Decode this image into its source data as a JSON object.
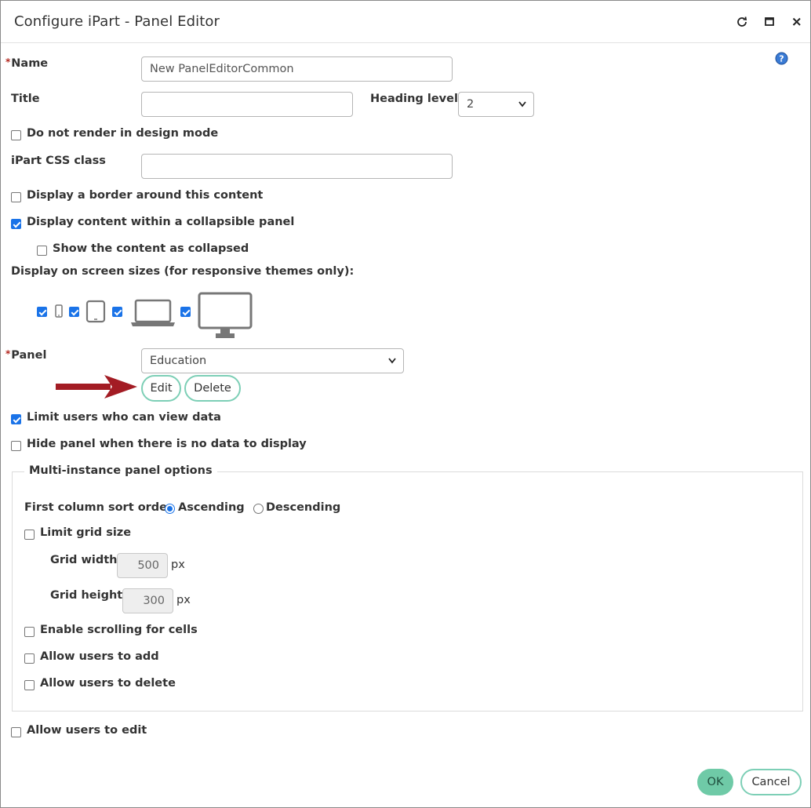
{
  "dialog": {
    "title": "Configure iPart - Panel Editor",
    "controls": [
      "refresh-icon",
      "maximize-icon",
      "close-icon"
    ]
  },
  "form": {
    "required_marker": "*",
    "name_label": "Name",
    "name_value": "New PanelEditorCommon",
    "title_label": "Title",
    "title_value": "",
    "heading_level_label": "Heading level",
    "heading_level_value": "2",
    "no_render_label": "Do not render in design mode",
    "no_render_checked": false,
    "css_class_label": "iPart CSS class",
    "css_class_value": "",
    "border_label": "Display a border around this content",
    "border_checked": false,
    "collapsible_label": "Display content within a collapsible panel",
    "collapsible_checked": true,
    "collapsed_label": "Show the content as collapsed",
    "collapsed_checked": false,
    "screen_sizes_label": "Display on screen sizes (for responsive themes only):",
    "screen_sizes": [
      {
        "device": "phone-icon",
        "checked": true
      },
      {
        "device": "tablet-icon",
        "checked": true
      },
      {
        "device": "laptop-icon",
        "checked": true
      },
      {
        "device": "desktop-icon",
        "checked": true
      }
    ],
    "panel_label": "Panel",
    "panel_value": "Education",
    "edit_label": "Edit",
    "delete_label": "Delete",
    "limit_users_label": "Limit users who can view data",
    "limit_users_checked": true,
    "hide_panel_label": "Hide panel when there is no data to display",
    "hide_panel_checked": false
  },
  "multi_instance": {
    "legend": "Multi-instance panel options",
    "sort_label": "First column sort order",
    "ascending_label": "Ascending",
    "descending_label": "Descending",
    "sort_selected": "Ascending",
    "limit_grid_label": "Limit grid size",
    "limit_grid_checked": false,
    "grid_width_label": "Grid width",
    "grid_width_value": "500",
    "grid_height_label": "Grid height",
    "grid_height_value": "300",
    "unit": "px",
    "scrolling_label": "Enable scrolling for cells",
    "scrolling_checked": false,
    "allow_add_label": "Allow users to add",
    "allow_add_checked": false,
    "allow_delete_label": "Allow users to delete",
    "allow_delete_checked": false
  },
  "allow_edit_label": "Allow users to edit",
  "allow_edit_checked": false,
  "footer": {
    "ok_label": "OK",
    "cancel_label": "Cancel"
  },
  "colors": {
    "accent_green": "#6fcaa7",
    "outline_green": "#7dcfb6",
    "checkbox_blue": "#1a73e8",
    "required_red": "#b3261e",
    "arrow_red": "#a31c24"
  }
}
